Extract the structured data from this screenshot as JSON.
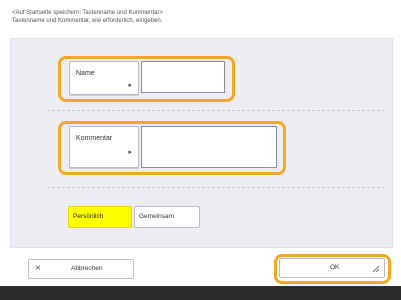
{
  "header": {
    "line1": "<Auf Startseite speichern: Tastenname und Kommentar>",
    "line2": "Tastenname und Kommentar, wie erforderlich, eingeben."
  },
  "name_field": {
    "button_label": "Name",
    "arrow": "▸",
    "value": ""
  },
  "comment_field": {
    "button_label": "Kommentar",
    "arrow": "▸",
    "value": ""
  },
  "scope": {
    "personal_label": "Persönlich",
    "shared_label": "Gemeinsam",
    "selected": "Persönlich"
  },
  "footer": {
    "cancel_icon": "×",
    "cancel_label": "Abbrechen",
    "ok_label": "OK",
    "ok_corner_icon": "resize-corner-icon"
  },
  "colors": {
    "highlight": "#f5a623",
    "selected": "#ffff00"
  }
}
